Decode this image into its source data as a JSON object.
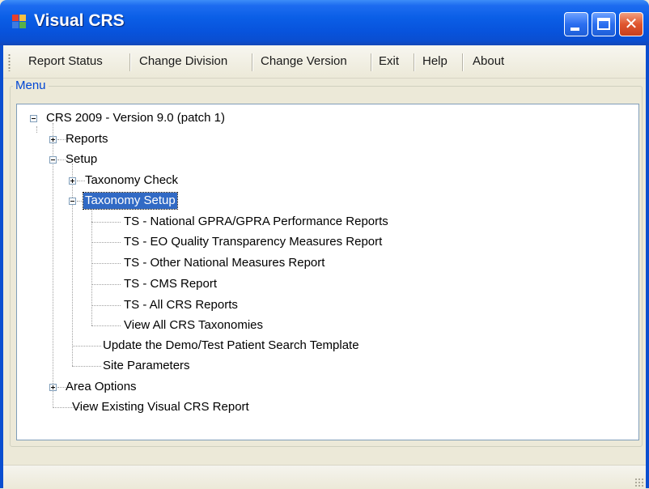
{
  "window": {
    "title": "Visual CRS",
    "title_color": "#ffffff",
    "titlebar_color": "#0a5ee6",
    "controls": {
      "minimize": "minimize-icon",
      "maximize": "maximize-icon",
      "close": "close-icon",
      "close_glyph": "✕"
    }
  },
  "menubar": {
    "items": [
      {
        "label": "Report Status"
      },
      {
        "label": "Change Division"
      },
      {
        "label": "Change Version"
      },
      {
        "label": "Exit"
      },
      {
        "label": "Help"
      },
      {
        "label": "About"
      }
    ]
  },
  "menu_group": {
    "label": "Menu",
    "label_color": "#0046d5"
  },
  "tree": {
    "selected_color": "#316ac5",
    "nodes": [
      {
        "label": "CRS 2009 - Version 9.0 (patch 1)",
        "state": "expanded",
        "level": 0
      },
      {
        "label": "Reports",
        "state": "collapsed",
        "level": 1
      },
      {
        "label": "Setup",
        "state": "expanded",
        "level": 1
      },
      {
        "label": "Taxonomy Check",
        "state": "collapsed",
        "level": 2
      },
      {
        "label": "Taxonomy Setup",
        "state": "expanded",
        "level": 2,
        "selected": true
      },
      {
        "label": "TS - National GPRA/GPRA Performance Reports",
        "state": "leaf",
        "level": 3
      },
      {
        "label": "TS - EO Quality Transparency Measures Report",
        "state": "leaf",
        "level": 3
      },
      {
        "label": "TS - Other National Measures Report",
        "state": "leaf",
        "level": 3
      },
      {
        "label": "TS - CMS Report",
        "state": "leaf",
        "level": 3
      },
      {
        "label": "TS - All CRS Reports",
        "state": "leaf",
        "level": 3
      },
      {
        "label": "View All CRS Taxonomies",
        "state": "leaf",
        "level": 3
      },
      {
        "label": "Update the Demo/Test Patient Search Template",
        "state": "leaf",
        "level": 2
      },
      {
        "label": "Site Parameters",
        "state": "leaf",
        "level": 2
      },
      {
        "label": "Area Options",
        "state": "collapsed",
        "level": 1
      },
      {
        "label": "View Existing Visual CRS Report",
        "state": "leaf",
        "level": 1
      }
    ]
  },
  "statusbar": {}
}
